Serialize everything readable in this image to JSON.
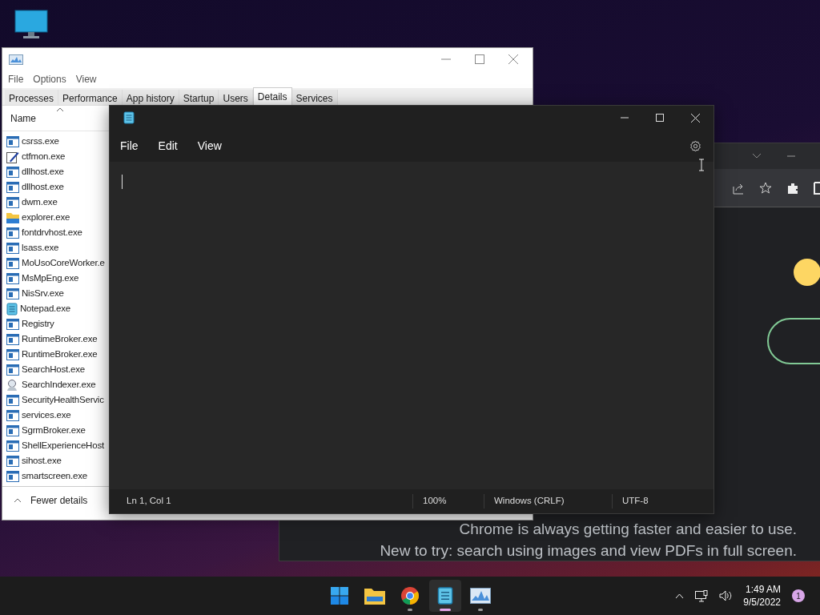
{
  "task_manager": {
    "menu": [
      "File",
      "Options",
      "View"
    ],
    "tabs": [
      {
        "label": "Processes",
        "selected": false
      },
      {
        "label": "Performance",
        "selected": false
      },
      {
        "label": "App history",
        "selected": false
      },
      {
        "label": "Startup",
        "selected": false
      },
      {
        "label": "Users",
        "selected": false
      },
      {
        "label": "Details",
        "selected": true
      },
      {
        "label": "Services",
        "selected": false
      }
    ],
    "column": "Name",
    "processes": [
      {
        "name": "csrss.exe",
        "kind": "app"
      },
      {
        "name": "ctfmon.exe",
        "kind": "pen"
      },
      {
        "name": "dllhost.exe",
        "kind": "app"
      },
      {
        "name": "dllhost.exe",
        "kind": "app"
      },
      {
        "name": "dwm.exe",
        "kind": "app"
      },
      {
        "name": "explorer.exe",
        "kind": "folder"
      },
      {
        "name": "fontdrvhost.exe",
        "kind": "app"
      },
      {
        "name": "lsass.exe",
        "kind": "app"
      },
      {
        "name": "MoUsoCoreWorker.e",
        "kind": "app"
      },
      {
        "name": "MsMpEng.exe",
        "kind": "app"
      },
      {
        "name": "NisSrv.exe",
        "kind": "app"
      },
      {
        "name": "Notepad.exe",
        "kind": "notepad"
      },
      {
        "name": "Registry",
        "kind": "app"
      },
      {
        "name": "RuntimeBroker.exe",
        "kind": "app"
      },
      {
        "name": "RuntimeBroker.exe",
        "kind": "app"
      },
      {
        "name": "SearchHost.exe",
        "kind": "app"
      },
      {
        "name": "SearchIndexer.exe",
        "kind": "search"
      },
      {
        "name": "SecurityHealthServic",
        "kind": "app"
      },
      {
        "name": "services.exe",
        "kind": "app"
      },
      {
        "name": "SgrmBroker.exe",
        "kind": "app"
      },
      {
        "name": "ShellExperienceHost",
        "kind": "app"
      },
      {
        "name": "sihost.exe",
        "kind": "app"
      },
      {
        "name": "smartscreen.exe",
        "kind": "app"
      }
    ],
    "footer": "Fewer details"
  },
  "notepad": {
    "menu": [
      "File",
      "Edit",
      "View"
    ],
    "status_bar": [
      "Ln 1, Col 1",
      "100%",
      "Windows (CRLF)",
      "UTF-8"
    ]
  },
  "chrome": {
    "lines": [
      "Chrome is always getting faster and easier to use.",
      "New to try: search using images and view PDFs in full screen."
    ]
  },
  "taskbar": {
    "apps": [
      {
        "kind": "start",
        "running": false,
        "active": false
      },
      {
        "kind": "explorer",
        "running": false,
        "active": false
      },
      {
        "kind": "chrome",
        "running": true,
        "active": false
      },
      {
        "kind": "notepad",
        "running": true,
        "active": true
      },
      {
        "kind": "taskmgr",
        "running": true,
        "active": false
      }
    ],
    "time": "1:49 AM",
    "date": "9/5/2022",
    "notifications": "1"
  }
}
